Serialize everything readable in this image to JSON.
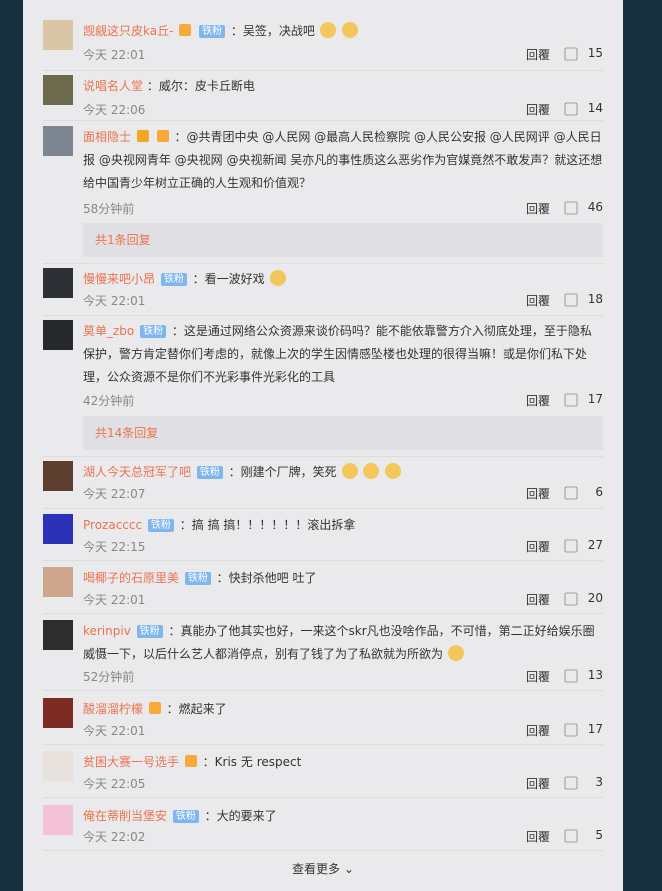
{
  "comments": [
    {
      "name": "觊觎这只皮ka丘-",
      "badge": "铁粉",
      "text": "：吴签，决战吧",
      "time": "今天 22:01",
      "reply": "回覆",
      "likes": "15"
    },
    {
      "name": "说唱名人堂",
      "badge": "",
      "text": "：威尔：皮卡丘断电",
      "time": "今天 22:06",
      "reply": "回覆",
      "likes": "14"
    },
    {
      "name": "面相隐士",
      "badge": "",
      "text": "：@共青团中央 @人民网 @最高人民检察院 @人民公安报 @人民网评 @人民日报 @央视网青年 @央视网 @央视新闻 吴亦凡的事性质这么恶劣作为官媒竟然不敢发声？就这还想给中国青少年树立正确的人生观和价值观？",
      "time": "58分钟前",
      "reply": "回覆",
      "likes": "46",
      "replies": "共1条回复"
    },
    {
      "name": "慢慢来吧小昂",
      "badge": "铁粉",
      "text": "：看一波好戏",
      "time": "今天 22:01",
      "reply": "回覆",
      "likes": "18"
    },
    {
      "name": "莫单_zbo",
      "badge": "铁粉",
      "text": "：这是通过网络公众资源来谈价码吗？能不能依靠警方介入彻底处理，至于隐私保护，警方肯定替你们考虑的，就像上次的学生因情感坠楼也处理的很得当嘛！或是你们私下处理，公众资源不是你们不光彩事件光彩化的工具",
      "time": "42分钟前",
      "reply": "回覆",
      "likes": "17",
      "replies": "共14条回复"
    },
    {
      "name": "湖人今天总冠军了吧",
      "badge": "铁粉",
      "text": "：刚建个厂牌，笑死",
      "time": "今天 22:07",
      "reply": "回覆",
      "likes": "6"
    },
    {
      "name": "Prozacccc",
      "badge": "铁粉",
      "text": "：搞 搞 搞！！！！！！滚出拆拿",
      "time": "今天 22:15",
      "reply": "回覆",
      "likes": "27"
    },
    {
      "name": "喝椰子的石原里美",
      "badge": "铁粉",
      "text": "：快封杀他吧 吐了",
      "time": "今天 22:01",
      "reply": "回覆",
      "likes": "20"
    },
    {
      "name": "kerinpiv",
      "badge": "铁粉",
      "text": "：真能办了他其实也好，一来这个skr凡也没啥作品，不可惜，第二正好给娱乐圈威慑一下，以后什么艺人都消停点，别有了钱了为了私欲就为所欲为",
      "time": "52分钟前",
      "reply": "回覆",
      "likes": "13"
    },
    {
      "name": "酸溜溜柠檬",
      "badge": "",
      "text": "：燃起来了",
      "time": "今天 22:01",
      "reply": "回覆",
      "likes": "17"
    },
    {
      "name": "贫困大赛一号选手",
      "badge": "",
      "text": "：Kris 无 respect",
      "time": "今天 22:05",
      "reply": "回覆",
      "likes": "3"
    },
    {
      "name": "俺在蒂削当堡安",
      "badge": "铁粉",
      "text": "：大的要来了",
      "time": "今天 22:02",
      "reply": "回覆",
      "likes": "5"
    }
  ],
  "load_more": "查看更多"
}
